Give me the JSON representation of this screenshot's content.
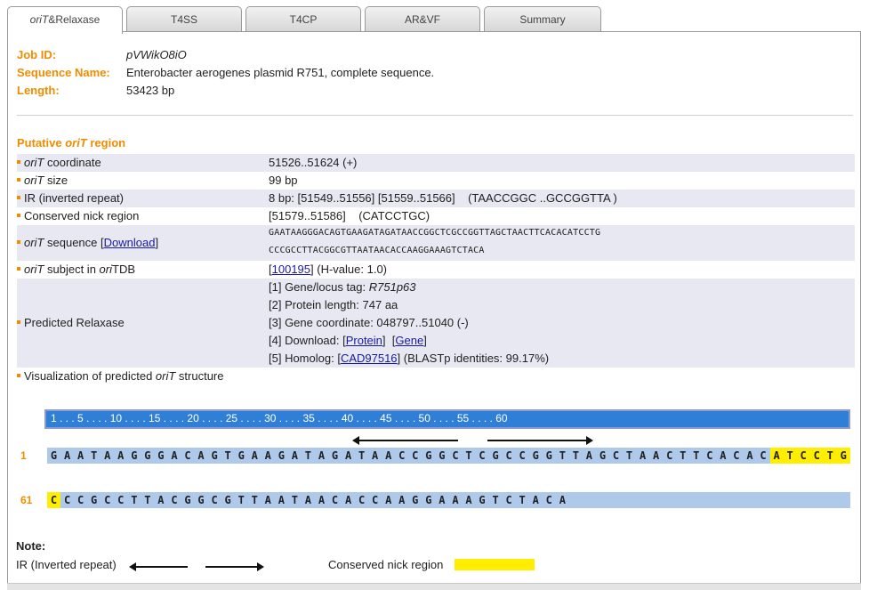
{
  "tabs": [
    {
      "label_italic": "oriT",
      "label_rest": "&Relaxase",
      "active": true
    },
    {
      "label": "T4SS"
    },
    {
      "label": "T4CP"
    },
    {
      "label": "AR&VF"
    },
    {
      "label": "Summary"
    }
  ],
  "job": {
    "id_label": "Job ID:",
    "id_value": "pVWikO8iO",
    "name_label": "Sequence Name:",
    "name_value": "Enterobacter aerogenes plasmid R751, complete sequence.",
    "length_label": "Length:",
    "length_value": "53423 bp"
  },
  "orit": {
    "section_title_pre": "Putative ",
    "section_title_it": "oriT",
    "section_title_post": " region",
    "coordinate_label_it": "oriT",
    "coordinate_label_rest": " coordinate",
    "coordinate_value": "51526..51624 (+)",
    "size_label_it": "oriT",
    "size_label_rest": " size",
    "size_value": "99 bp",
    "ir_label": "IR (inverted repeat)",
    "ir_value": "8 bp: [51549..51556] [51559..51566]    (TAACCGGC ..GCCGGTTA )",
    "nick_label": "Conserved nick region",
    "nick_value": "[51579..51586]    (CATCCTGC)",
    "seq_label_it": "oriT",
    "seq_label_rest": " sequence [",
    "seq_download": "Download",
    "seq_label_end": "]",
    "seq_line1": "GAATAAGGGACAGTGAAGATAGATAACCGGCTCGCCGGTTAGCTAACTTCACACATCCTG",
    "seq_line2": "CCCGCCTTACGGCGTTAATAACACCAAGGAAAGTCTACA",
    "subject_label_it": "oriT",
    "subject_label_mid": " subject in ",
    "subject_label_it2": "ori",
    "subject_label_end": "TDB",
    "subject_link": "100195",
    "subject_hvalue": "(H-value: 1.0)",
    "relaxase_label": "Predicted Relaxase",
    "relaxase_1_pre": "[1] Gene/locus tag: ",
    "relaxase_1_it": "R751p63",
    "relaxase_2": "[2] Protein length: 747 aa",
    "relaxase_3": "[3] Gene coordinate: 048797..51040 (-)",
    "relaxase_4_pre": "[4] Download: [",
    "relaxase_4_protein": "Protein",
    "relaxase_4_mid": "]  [",
    "relaxase_4_gene": "Gene",
    "relaxase_4_end": "]",
    "relaxase_5_pre": "[5] Homolog: [",
    "relaxase_5_link": "CAD97516",
    "relaxase_5_end": "] (BLASTp identities: 99.17%)",
    "viz_label_pre": "Visualization of predicted ",
    "viz_label_it": "oriT",
    "viz_label_post": " structure"
  },
  "viz": {
    "ruler_text": "1 . . . 5 . . . . 10 . . . . 15 . . . . 20 . . . . 25 . . . . 30 . . . . 35 . . . . 40 . . . . 45 . . . . 50 . . . . 55 . . . . 60",
    "row1_num": "1",
    "row1_seq": "GAATAAGGGACAGTGAAGATAGATAACCGGCTCGCCGGTTAGCTAACTTCACACATCCTG",
    "row2_num": "61",
    "row2_seq": "CCCGCCTTACGGCGTTAATAACACCAAGGAAAGTCTACA",
    "nick_highlight_row1_from": 54,
    "nick_highlight_row2_count": 1,
    "highlight_color": "#ffee00"
  },
  "note": {
    "title": "Note:",
    "ir_label": "IR (Inverted repeat)",
    "nick_label": "Conserved nick region"
  },
  "colors": {
    "accent": "#f08c00",
    "link": "#1a1aa6",
    "ruler": "#2f7fd6",
    "seqbar": "#aec9ea"
  }
}
